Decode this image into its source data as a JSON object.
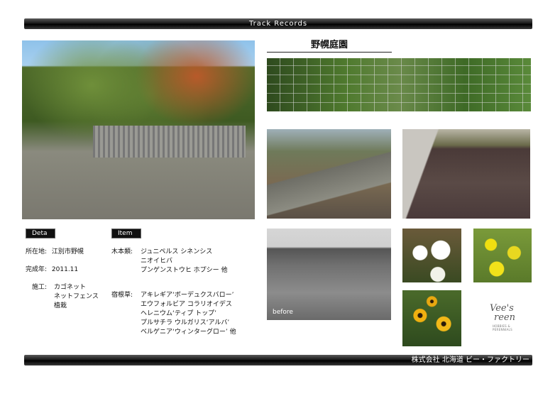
{
  "header": {
    "title": "Track Records"
  },
  "project": {
    "name": "野幌庭園"
  },
  "labels": {
    "deta": "Deta",
    "item": "Item"
  },
  "deta": {
    "location_key": "所在地:",
    "location_val": "江別市野幌",
    "completed_key": "完成年:",
    "completed_val": "2011.11",
    "works_key": "施工:",
    "works": [
      "カゴネット",
      "ネットフェンス",
      "植栽"
    ]
  },
  "item": {
    "trees_key": "木本類:",
    "trees": [
      "ジュニペルス  シネンシス",
      "ニオイヒバ",
      "プンゲンストウヒ  ホプシー     他"
    ],
    "herbs_key": "宿根草:",
    "herbs": [
      "アキレギア‘ボーデュクスバロー’",
      "エウフォルビア  コラリオイデス",
      "ヘレニウム‘ティプ トップ’",
      "プルサチラ  ウルガリス‘アルバ’",
      "ベルゲニア‘ウィンターグロー’  他"
    ]
  },
  "photo_caption": {
    "before": "before"
  },
  "logo": {
    "line1": "Vee's",
    "line2": "reen",
    "tagline": "HOBBIES & PERENNIALS"
  },
  "footer": {
    "company": "株式会社  北海道  ビー・ファクトリー"
  }
}
